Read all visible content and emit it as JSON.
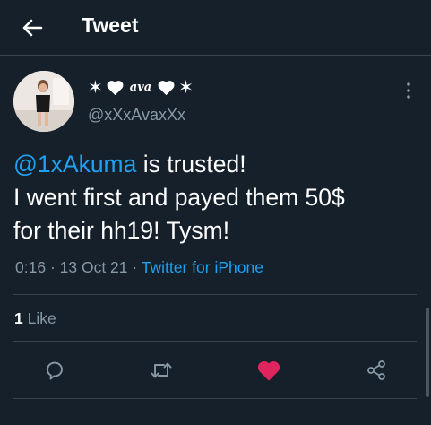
{
  "header": {
    "title": "Tweet"
  },
  "tweet": {
    "display_name_left": "✶",
    "display_name_mid": "ava",
    "display_name_right": "✶",
    "handle": "@xXxAvaxXx",
    "mention": "@1xAkuma",
    "text_line1_rest": " is trusted!",
    "text_line2": "I went first and payed them 50$",
    "text_line3": "for their hh19! Tysm!",
    "time": "0:16",
    "date": "13 Oct 21",
    "separator": "·",
    "source": "Twitter for iPhone",
    "like_count": "1",
    "like_label": "Like"
  },
  "icons": [
    "back-arrow-icon",
    "more-vertical-icon",
    "reply-icon",
    "retweet-icon",
    "like-heart-icon",
    "share-icon",
    "heart-icon"
  ],
  "colors": {
    "background": "#15202b",
    "accent": "#1da1f2",
    "muted": "#8899a6",
    "like": "#e0245e",
    "divider": "#38444d"
  }
}
